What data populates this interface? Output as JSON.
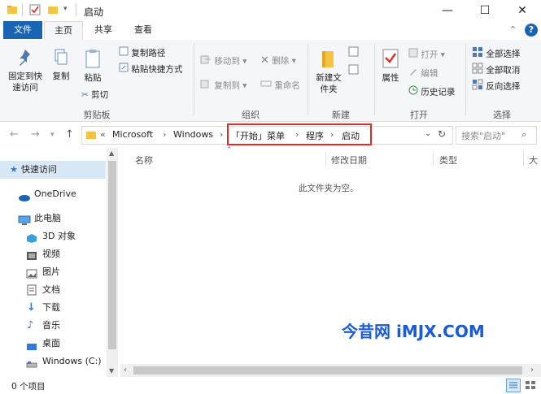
{
  "window": {
    "title": "启动",
    "controls": {
      "minimize": "—",
      "maximize": "☐",
      "close": "✕"
    }
  },
  "ribbon_tabs": {
    "file": "文件",
    "home": "主页",
    "share": "共享",
    "view": "查看"
  },
  "ribbon": {
    "clipboard": {
      "label": "剪贴板",
      "pin": "固定到快速访问",
      "copy": "复制",
      "paste": "粘贴",
      "copy_path": "复制路径",
      "paste_shortcut": "粘贴快捷方式",
      "cut": "剪切"
    },
    "organize": {
      "label": "组织",
      "move_to": "移动到",
      "copy_to": "复制到",
      "delete": "删除",
      "rename": "重命名"
    },
    "new": {
      "label": "新建",
      "new_folder": "新建文件夹"
    },
    "open": {
      "label": "打开",
      "properties": "属性",
      "open": "打开",
      "edit": "编辑",
      "history": "历史记录"
    },
    "select": {
      "label": "选择",
      "select_all": "全部选择",
      "select_none": "全部取消",
      "invert": "反向选择"
    }
  },
  "address": {
    "prefix": "«",
    "crumbs": [
      "Microsoft",
      "Windows",
      "「开始」菜单",
      "程序",
      "启动"
    ],
    "sep": "›",
    "search_placeholder": "搜索\"启动\""
  },
  "nav": {
    "quick_access": "快速访问",
    "onedrive": "OneDrive",
    "this_pc": "此电脑",
    "items": [
      "3D 对象",
      "视频",
      "图片",
      "文档",
      "下载",
      "音乐",
      "桌面",
      "Windows (C:)"
    ]
  },
  "columns": {
    "name": "名称",
    "modified": "修改日期",
    "type": "类型",
    "size": "大"
  },
  "empty_message": "此文件夹为空。",
  "status": {
    "count": "0 个项目"
  },
  "watermark": "今昔网 iMJX.COM",
  "colors": {
    "accent": "#1a64b4",
    "highlight": "#e02b2b",
    "selection": "#d9e8f7"
  }
}
